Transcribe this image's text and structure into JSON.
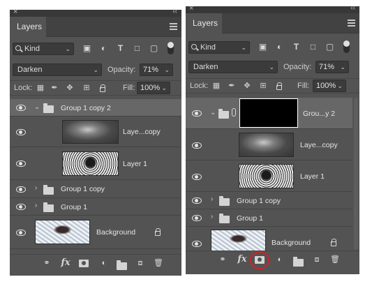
{
  "panels": [
    {
      "id": "left",
      "tab": "Layers",
      "filter_kind": "Kind",
      "blend_mode": "Darken",
      "opacity_label": "Opacity:",
      "opacity_value": "71%",
      "lock_label": "Lock:",
      "fill_label": "Fill:",
      "fill_value": "100%",
      "layers": [
        {
          "name": "Group 1 copy 2",
          "kind": "group",
          "expanded": true,
          "selected": true
        },
        {
          "name": "Laye...copy",
          "kind": "layer",
          "thumb": "dark"
        },
        {
          "name": "Layer 1",
          "kind": "layer",
          "thumb": "splat"
        },
        {
          "name": "Group 1 copy",
          "kind": "group",
          "expanded": false
        },
        {
          "name": "Group 1",
          "kind": "group",
          "expanded": false
        },
        {
          "name": "Background",
          "kind": "background",
          "thumb": "bg",
          "locked": true
        }
      ]
    },
    {
      "id": "right",
      "tab": "Layers",
      "filter_kind": "Kind",
      "blend_mode": "Darken",
      "opacity_label": "Opacity:",
      "opacity_value": "71%",
      "lock_label": "Lock:",
      "fill_label": "Fill:",
      "fill_value": "100%",
      "layers": [
        {
          "name": "Grou...y 2",
          "kind": "group",
          "expanded": true,
          "selected": true,
          "has_mask": true
        },
        {
          "name": "Laye...copy",
          "kind": "layer",
          "thumb": "dark"
        },
        {
          "name": "Layer 1",
          "kind": "layer",
          "thumb": "splat"
        },
        {
          "name": "Group 1 copy",
          "kind": "group",
          "expanded": false
        },
        {
          "name": "Group 1",
          "kind": "group",
          "expanded": false
        },
        {
          "name": "Background",
          "kind": "background",
          "thumb": "bg",
          "locked": true
        }
      ],
      "highlighted_button": "add-layer-mask"
    }
  ],
  "icons": {
    "close": "×",
    "collapse": "‹‹",
    "filter_pixel": "image-icon",
    "filter_adjust": "adjustment-icon",
    "filter_type": "T",
    "filter_shape": "shape-icon",
    "filter_smart": "smart-object-icon",
    "link": "link-icon",
    "fx": "fx",
    "mask": "mask-icon",
    "adjustment": "adjustment-layer-icon",
    "new_group": "folder-icon",
    "new_layer": "new-layer-icon",
    "delete": "trash-icon"
  },
  "colors": {
    "panel_bg": "#535353",
    "selected_row": "#676767",
    "highlight_ring": "#d32222"
  }
}
